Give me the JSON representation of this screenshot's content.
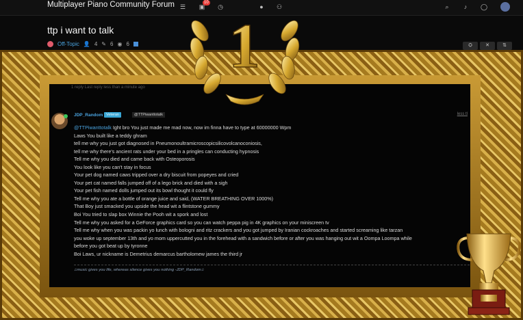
{
  "header": {
    "brand": "Multiplayer Piano Community Forum",
    "notification_count": "10"
  },
  "topic": {
    "title": "ttp i want to talk",
    "category": "Off-Topic",
    "posters": "4",
    "posts": "6",
    "views": "6"
  },
  "post": {
    "username": "JDP_Random",
    "group": "Veteran",
    "reply_to": "@TTPiwanttotalk",
    "time": "less tl",
    "mention": "@TTPiwanttotalk",
    "first_line_rest": " Ight bro You just made me mad now, now im finna have to type at 60000000 Wpm",
    "lines": [
      "Laws You built like a teddy ghram",
      "tell me why you just got diagnosed in Pneumonoultramicroscopicsilicovolcanoconiosis,",
      "tell me why there's ancient rats under your bed in a pringles can conducting hypnosis",
      "Tell me why you died and came back with Osteoporosis",
      "You look like you can't stay in focus",
      "Your pet dog named caws tripped over a dry biscuit from popeyes and cried",
      "Your pet cat named falls jumped off of a lego brick and died with a sigh",
      "Your pet fish named dolls jumped out its bowl thought it could fly",
      "Tell me why you ate a bottle of orange juice and said, (WATER BREATHING OVER 1000%)",
      "That Boy just smacked you upside the head wit a flintstone gummy",
      "Boi You tried to slap box Winnie the Pooh wit a spork and lost",
      "Tell me why you asked for a GeForce graphics card so you can watch peppa pig in 4K graphics on your miniscreen tv",
      "Tell me why when you was packin yo lunch with bologni and ritz crackers and you got jumped by Iranian cockroaches and started screaming like tarzan",
      "you woke up september 13th and yo mom uppercutted you in the forehead with a sandwich before or after you was hanging out wit a Oompa Loompa while",
      "before you got beat up by tyronne",
      "Boi Laws, ur nickname is Demetrius demarcus bartholomew james the third jr"
    ],
    "signature": "♫music gives you life, whereas silence gives you nothing -JDP_Random♫",
    "prev_hint": "1 reply Last reply less than a minute ago"
  },
  "overlay": {
    "laurel_numeral": "1"
  }
}
